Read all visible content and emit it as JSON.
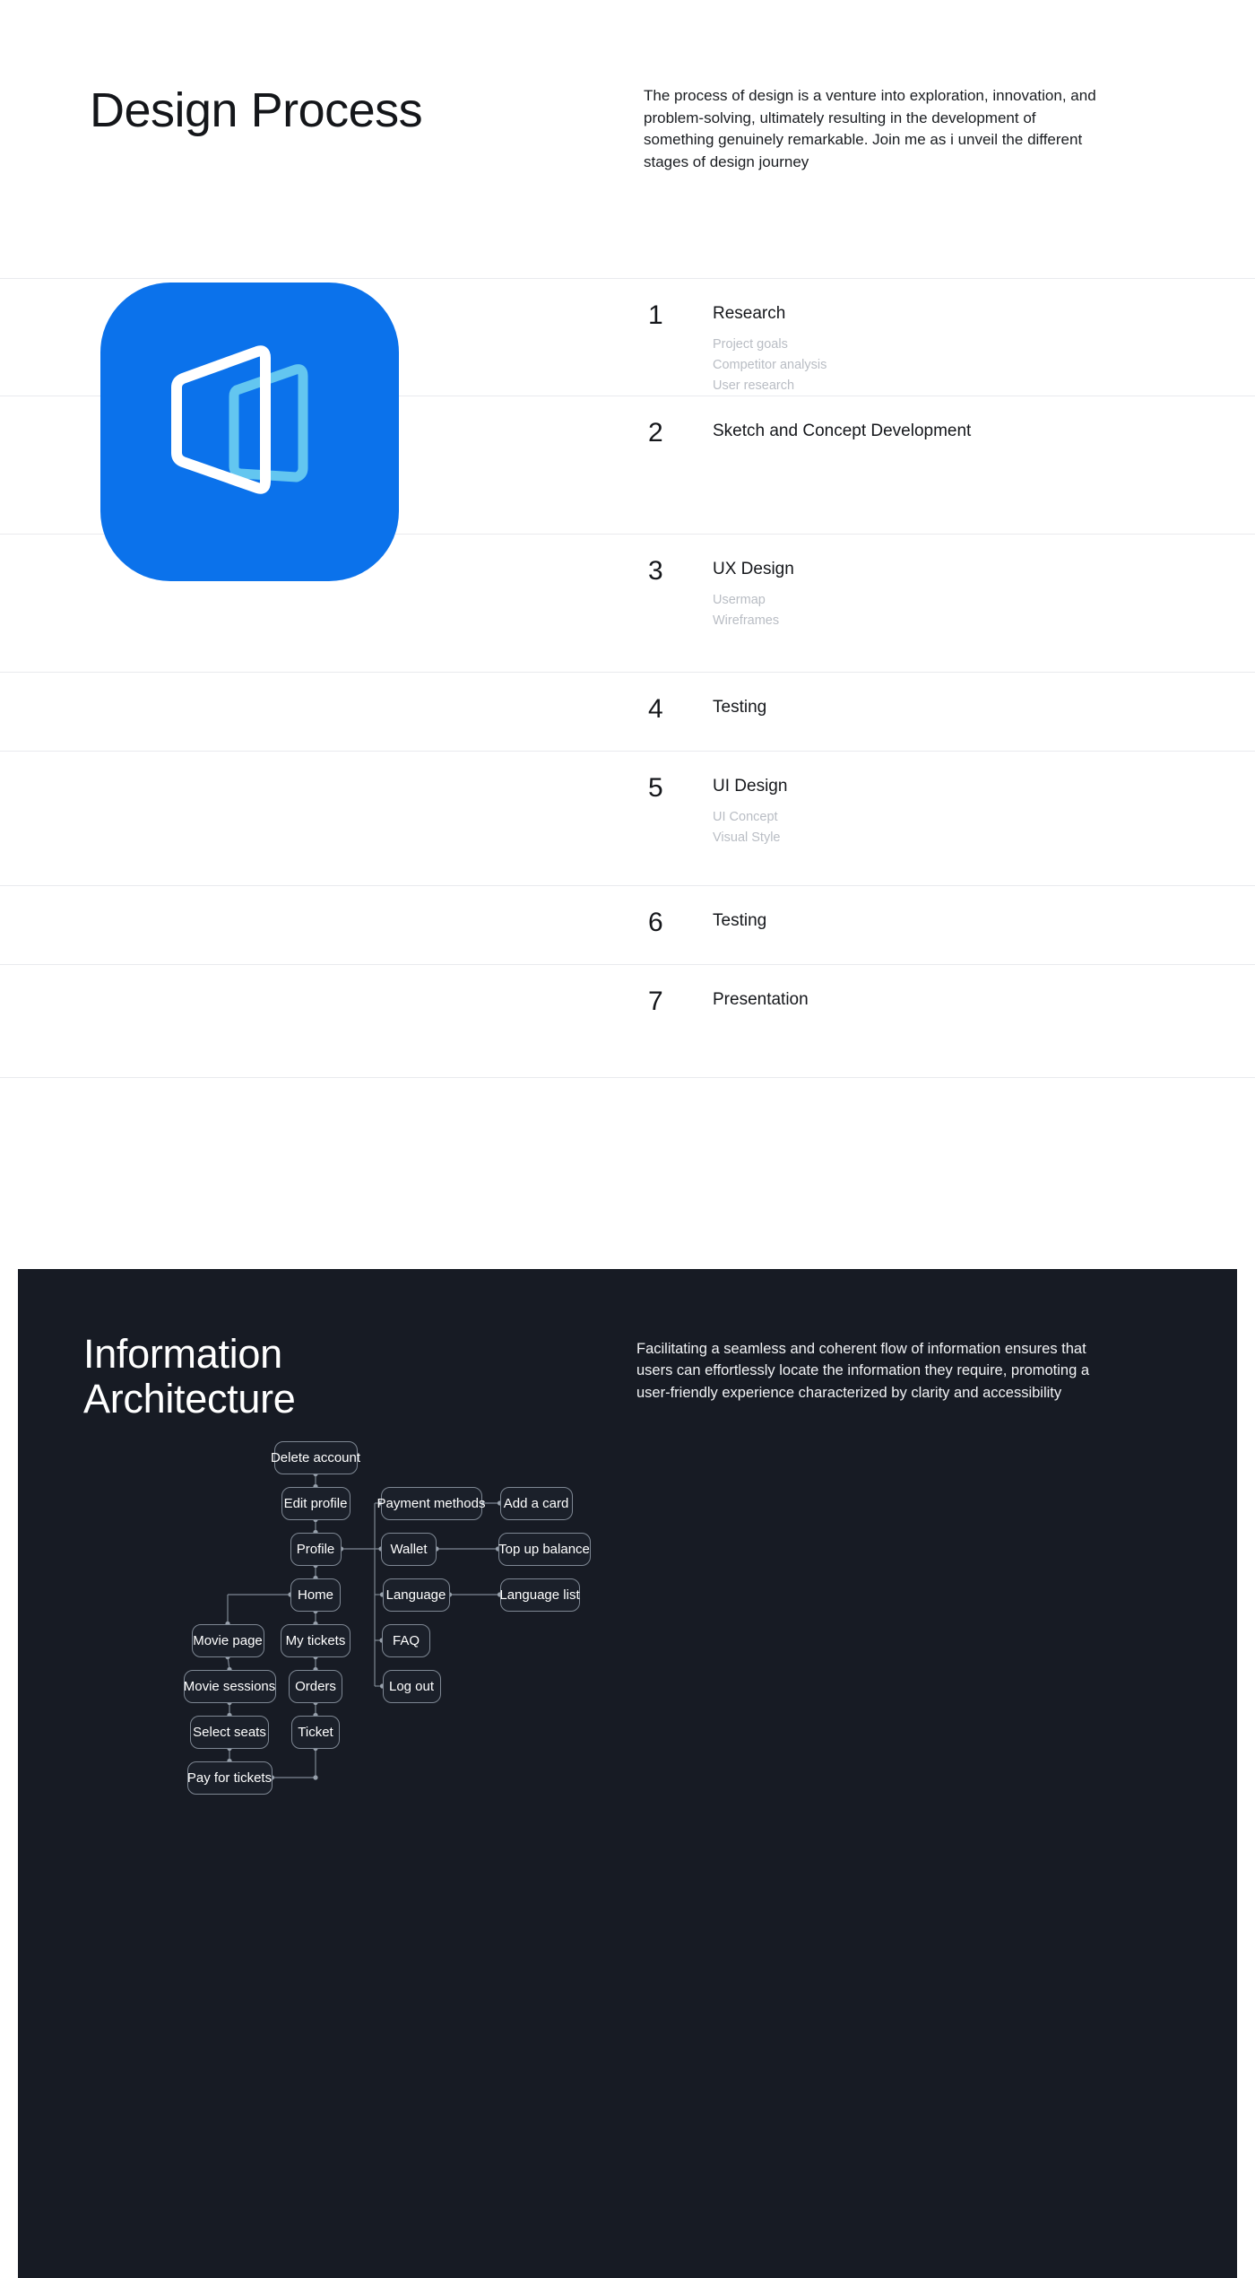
{
  "hero": {
    "title": "Design Process",
    "description": "The process of design is a venture into exploration, innovation, and problem-solving, ultimately resulting in the development of something genuinely remarkable. Join me as i unveil the different stages of design journey"
  },
  "app_icon": {
    "name": "app-icon",
    "background_color": "#0b72eb",
    "front_shape_color": "#ffffff",
    "back_shape_color": "#63c6f0"
  },
  "steps": [
    {
      "number": "1",
      "title": "Research",
      "subs": [
        "Project goals",
        "Competitor analysis",
        "User research"
      ]
    },
    {
      "number": "2",
      "title": "Sketch and Concept Development",
      "subs": []
    },
    {
      "number": "3",
      "title": "UX Design",
      "subs": [
        "Usermap",
        "Wireframes"
      ]
    },
    {
      "number": "4",
      "title": "Testing",
      "subs": []
    },
    {
      "number": "5",
      "title": "UI Design",
      "subs": [
        "UI Concept",
        "Visual Style"
      ]
    },
    {
      "number": "6",
      "title": "Testing",
      "subs": []
    },
    {
      "number": "7",
      "title": "Presentation",
      "subs": []
    }
  ],
  "information_architecture": {
    "title_line1": "Information",
    "title_line2": "Architecture",
    "description": "Facilitating a seamless and coherent flow of information ensures that users can effortlessly locate the information they require, promoting a user-friendly experience characterized by clarity and accessibility",
    "background_color": "#171b24",
    "node_border_color": "#7e8793",
    "nodes": [
      {
        "id": "delete-account",
        "label": "Delete account"
      },
      {
        "id": "edit-profile",
        "label": "Edit profile"
      },
      {
        "id": "profile",
        "label": "Profile"
      },
      {
        "id": "home",
        "label": "Home"
      },
      {
        "id": "movie-page",
        "label": "Movie page"
      },
      {
        "id": "my-tickets",
        "label": "My tickets"
      },
      {
        "id": "movie-sessions",
        "label": "Movie sessions"
      },
      {
        "id": "orders",
        "label": "Orders"
      },
      {
        "id": "select-seats",
        "label": "Select seats"
      },
      {
        "id": "ticket",
        "label": "Ticket"
      },
      {
        "id": "pay-for-tickets",
        "label": "Pay for tickets"
      },
      {
        "id": "payment-methods",
        "label": "Payment methods"
      },
      {
        "id": "wallet",
        "label": "Wallet"
      },
      {
        "id": "language",
        "label": "Language"
      },
      {
        "id": "faq",
        "label": "FAQ"
      },
      {
        "id": "log-out",
        "label": "Log out"
      },
      {
        "id": "add-a-card",
        "label": "Add a card"
      },
      {
        "id": "top-up-balance",
        "label": "Top up balance"
      },
      {
        "id": "language-list",
        "label": "Language list"
      }
    ]
  }
}
